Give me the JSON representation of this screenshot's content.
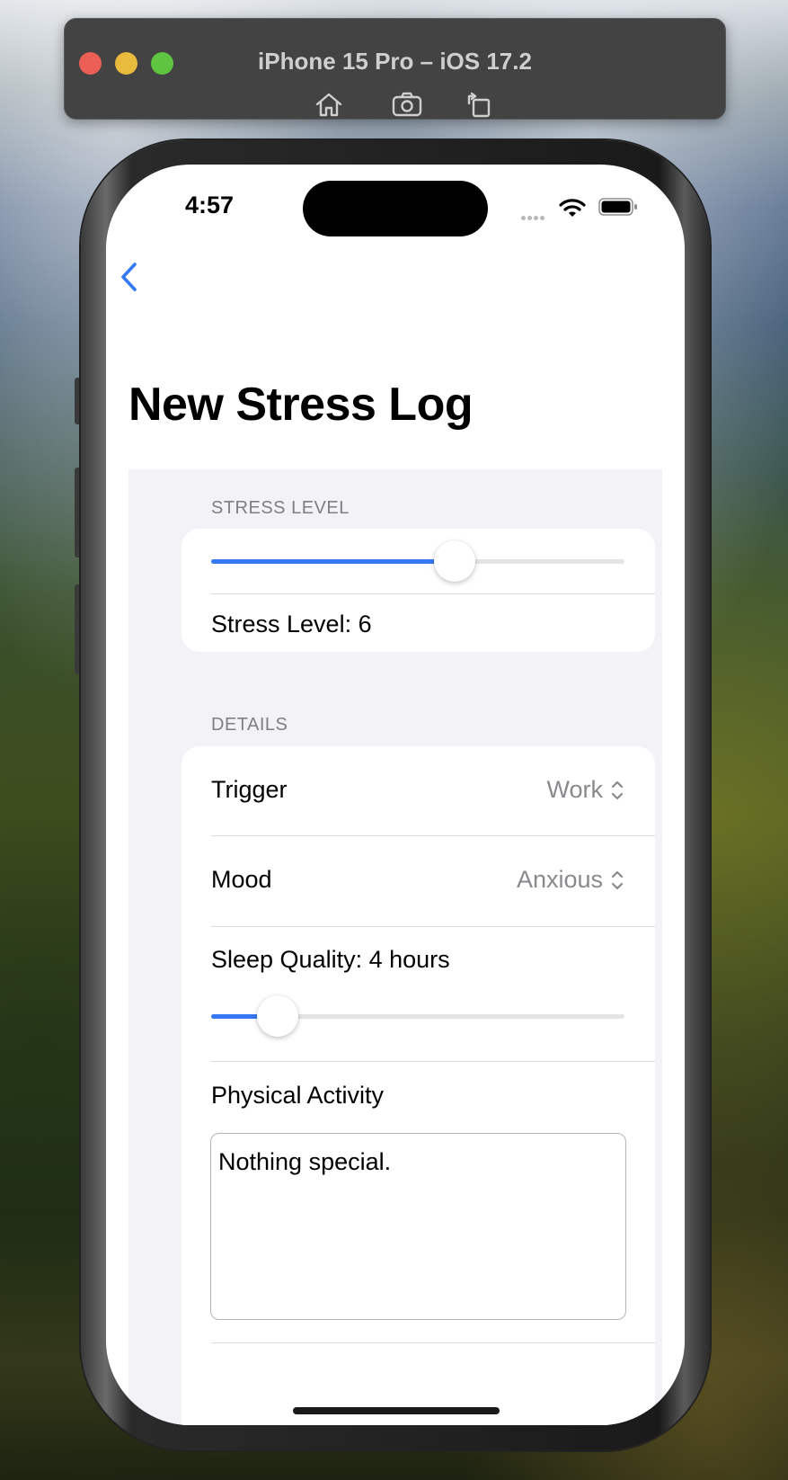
{
  "simulator": {
    "title": "iPhone 15 Pro – iOS 17.2",
    "tools": [
      "home-icon",
      "screenshot-icon",
      "rotate-icon"
    ]
  },
  "status_bar": {
    "time": "4:57"
  },
  "nav": {
    "back_icon": "chevron-left-icon"
  },
  "page": {
    "title": "New Stress Log"
  },
  "stress_section": {
    "header": "STRESS LEVEL",
    "slider_fraction": 0.59,
    "value_label": "Stress Level: 6"
  },
  "details_section": {
    "header": "DETAILS",
    "trigger": {
      "label": "Trigger",
      "value": "Work"
    },
    "mood": {
      "label": "Mood",
      "value": "Anxious"
    },
    "sleep": {
      "label": "Sleep Quality: 4 hours",
      "slider_fraction": 0.16
    },
    "activity": {
      "label": "Physical Activity",
      "text": "Nothing special."
    }
  },
  "colors": {
    "accent": "#3478f6",
    "grouped_background": "#f2f2f7",
    "secondary_text": "#8a8a8e"
  }
}
